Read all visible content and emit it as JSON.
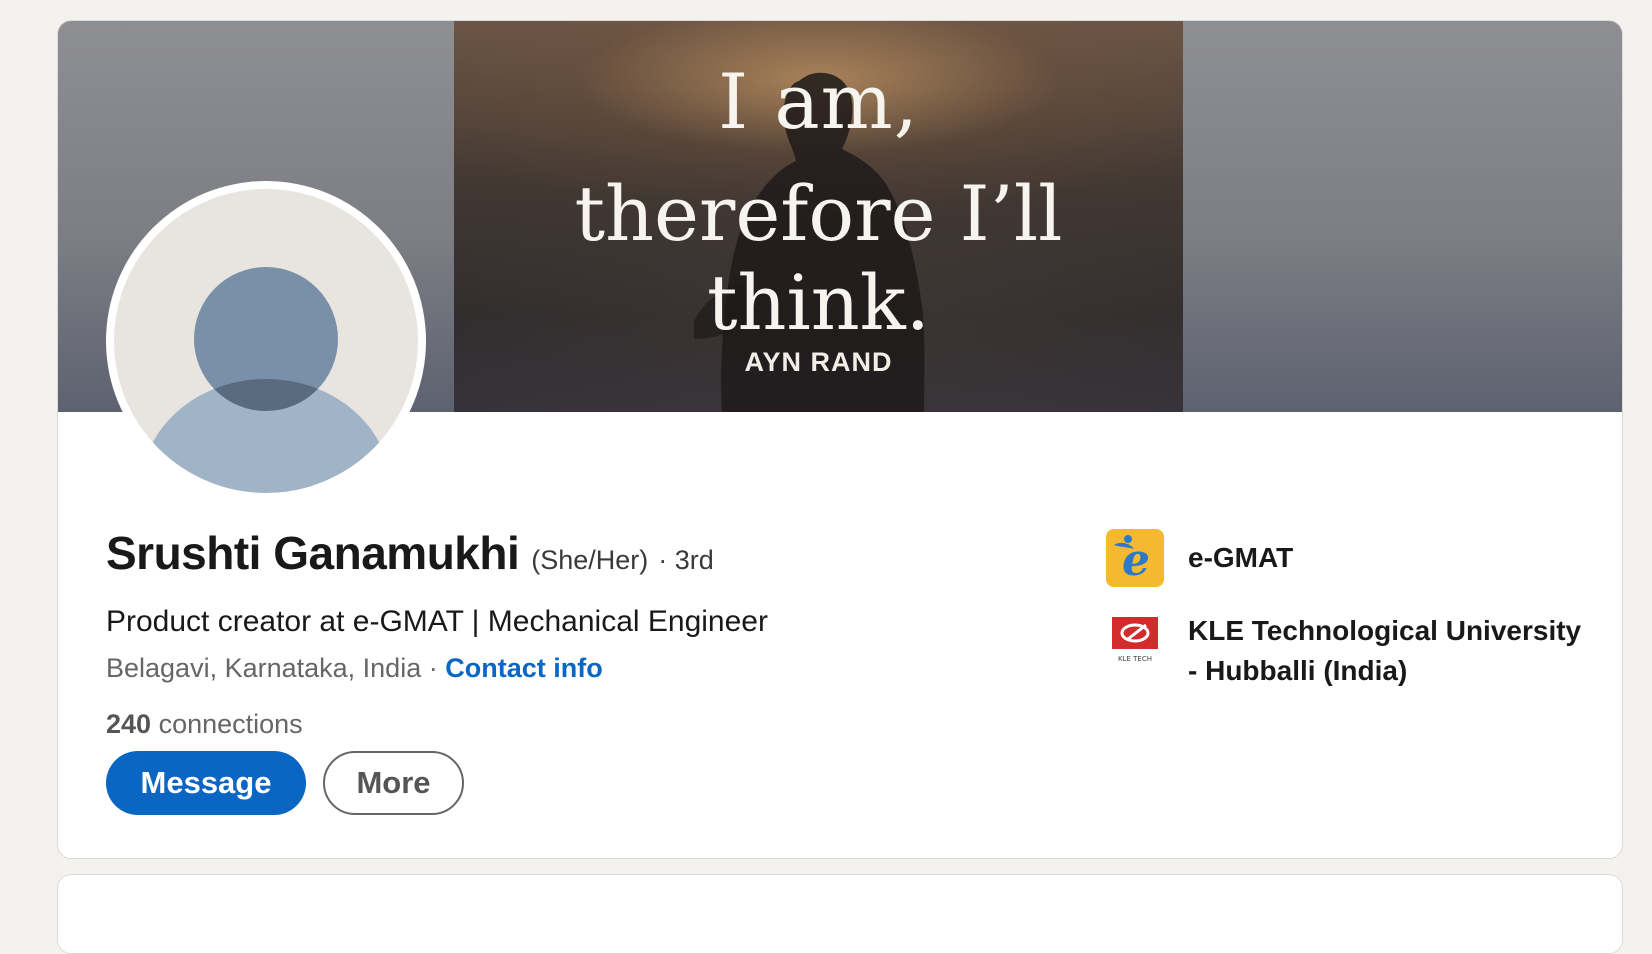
{
  "banner": {
    "quote_line1": "I am,",
    "quote_line2": "therefore I’ll think.",
    "author": "AYN RAND"
  },
  "profile": {
    "name": "Srushti Ganamukhi",
    "pronouns": "(She/Her)",
    "degree": "· 3rd",
    "headline": "Product creator at e-GMAT | Mechanical Engineer",
    "location": "Belagavi, Karnataka, India",
    "separator": "·",
    "contact_label": "Contact info",
    "connections_count": "240",
    "connections_label": "connections"
  },
  "actions": {
    "message_label": "Message",
    "more_label": "More"
  },
  "organizations": [
    {
      "name": "e-GMAT",
      "icon": "e-gmat-logo"
    },
    {
      "name": "KLE Technological University - Hubballi (India)",
      "icon": "kle-tech-logo",
      "logo_text": "KLE TECH"
    }
  ],
  "colors": {
    "primary": "#0a66c2",
    "background": "#f3f2ef",
    "avatar_bg": "#e8e5e1",
    "avatar_figure": "#7a8fa8"
  }
}
